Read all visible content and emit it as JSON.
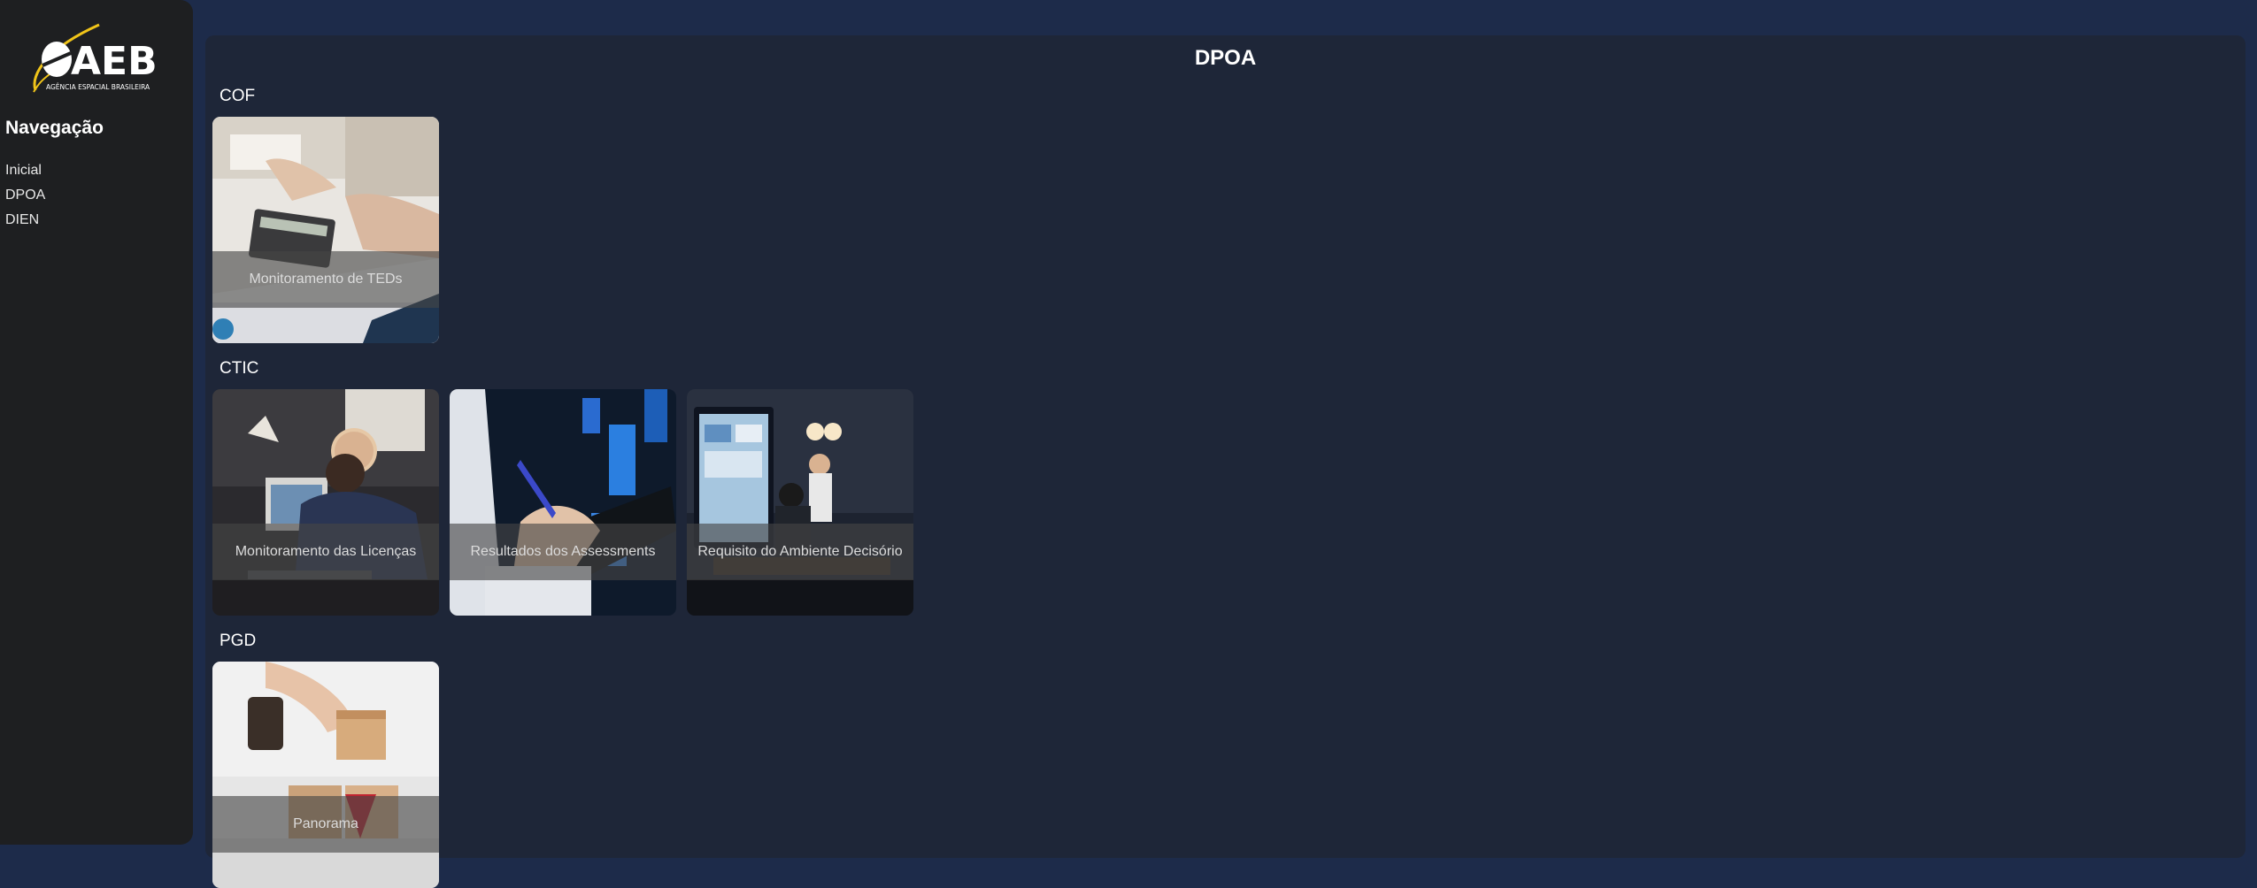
{
  "logo": {
    "name": "AEB",
    "subtitle": "AGÊNCIA ESPACIAL BRASILEIRA"
  },
  "sidebar": {
    "title": "Navegação",
    "items": [
      {
        "label": "Inicial"
      },
      {
        "label": "DPOA"
      },
      {
        "label": "DIEN"
      }
    ]
  },
  "main": {
    "title": "DPOA",
    "sections": [
      {
        "title": "COF",
        "cards": [
          {
            "label": "Monitoramento de TEDs",
            "image": "finance-calculator-photo"
          }
        ]
      },
      {
        "title": "CTIC",
        "cards": [
          {
            "label": "Monitoramento das Licenças",
            "image": "office-worker-computer-photo"
          },
          {
            "label": "Resultados dos Assessments",
            "image": "hand-writing-tablet-photo"
          },
          {
            "label": "Requisito do Ambiente Decisório",
            "image": "meeting-dashboard-screen-photo"
          }
        ]
      },
      {
        "title": "PGD",
        "cards": [
          {
            "label": "Panorama",
            "image": "wooden-blocks-photo"
          }
        ]
      }
    ]
  },
  "colors": {
    "page_background": "#1d2b4a",
    "sidebar_background": "#1e1f21",
    "main_panel": "#1e2638",
    "logo_accent": "#f0c419"
  }
}
